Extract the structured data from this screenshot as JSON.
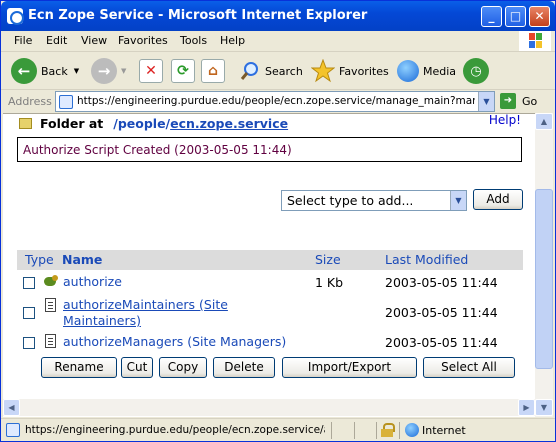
{
  "window": {
    "title": "Ecn Zope Service - Microsoft Internet Explorer",
    "buttons": {
      "minimize": "_",
      "maximize": "□",
      "close": "✕"
    }
  },
  "menubar": {
    "items": [
      "File",
      "Edit",
      "View",
      "Favorites",
      "Tools",
      "Help"
    ]
  },
  "toolbar": {
    "back": "Back",
    "search": "Search",
    "favorites": "Favorites",
    "media": "Media"
  },
  "addressbar": {
    "label": "Address",
    "url": "https://engineering.purdue.edu/people/ecn.zope.service/manage_main?manage_tabs_message=Authorize",
    "go": "Go"
  },
  "page": {
    "folder_label": "Folder at",
    "path_part1": "/people/",
    "path_part2": "ecn.zope.service",
    "help": "Help!",
    "message": "Authorize Script Created (2003-05-05 11:44)",
    "add_select": "Select type to add...",
    "add_button": "Add",
    "table": {
      "headers": {
        "type": "Type",
        "name": "Name",
        "size": "Size",
        "modified": "Last Modified"
      },
      "rows": [
        {
          "name": "authorize",
          "name_line2": "",
          "size": "1 Kb",
          "modified": "2003-05-05 11:44",
          "icon": "python-script-icon"
        },
        {
          "name": "authorizeMaintainers (Site",
          "name_line2": "Maintainers)",
          "size": "",
          "modified": "2003-05-05 11:44",
          "icon": "document-icon"
        },
        {
          "name": "authorizeManagers (Site Managers)",
          "name_line2": "",
          "size": "",
          "modified": "2003-05-05 11:44",
          "icon": "document-icon"
        }
      ]
    },
    "actions": {
      "rename": "Rename",
      "cut": "Cut",
      "copy": "Copy",
      "delete": "Delete",
      "import_export": "Import/Export",
      "select_all": "Select All"
    }
  },
  "statusbar": {
    "url": "https://engineering.purdue.edu/people/ecn.zope.service/authorize",
    "zone": "Internet"
  },
  "colors": {
    "link": "#1a4ab8",
    "message": "#600040",
    "titlebar": "#0448d6",
    "header_row": "#dcdcdc"
  }
}
